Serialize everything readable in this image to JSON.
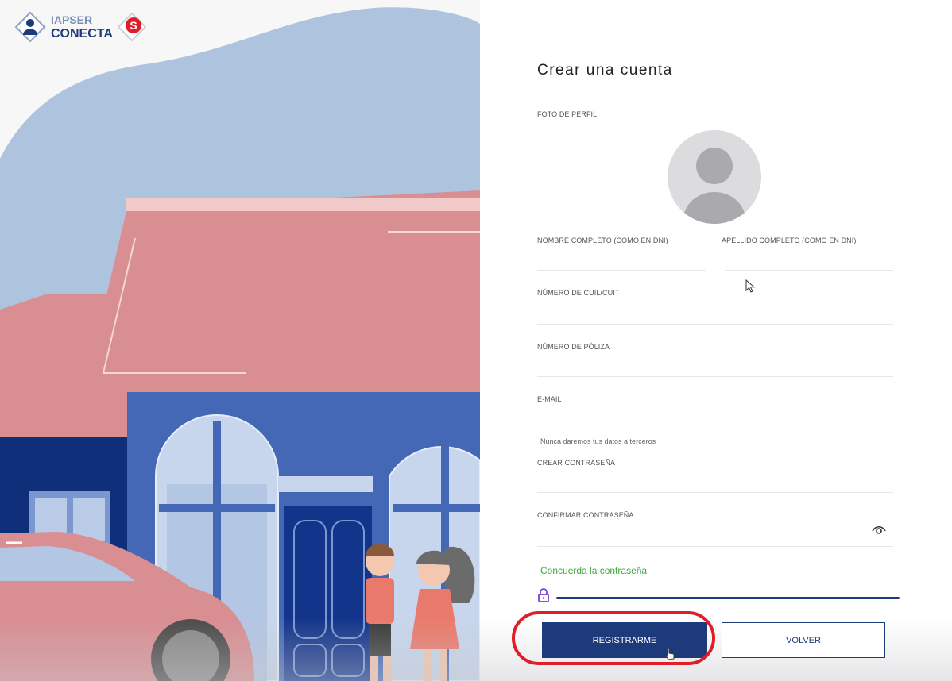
{
  "brand": {
    "line1": "IAPSER",
    "line2": "CONECTA",
    "badge": "S"
  },
  "form": {
    "title": "Crear una cuenta",
    "profile_photo_label": "FOTO DE PERFIL",
    "first_name_label": "NOMBRE COMPLETO (COMO EN DNI)",
    "last_name_label": "APELLIDO COMPLETO (COMO EN DNI)",
    "cuil_label": "NÚMERO DE CUIL/CUIT",
    "policy_label": "NÚMERO DE PÓLIZA",
    "email_label": "E-MAIL",
    "email_hint": "Nunca daremos tus datos a terceros",
    "password_label": "CREAR CONTRASEÑA",
    "confirm_password_label": "CONFIRMAR CONTRASEÑA",
    "password_match": "Concuerda la contraseña",
    "register_button": "REGISTRARME",
    "back_button": "VOLVER"
  },
  "colors": {
    "primary": "#1d3b7a",
    "success": "#3caa3c",
    "highlight": "#e01e2a",
    "lock": "#7b3fd1"
  },
  "icons": [
    "profile-avatar-icon",
    "eye-icon",
    "lock-icon",
    "arrow-cursor",
    "hand-cursor"
  ]
}
